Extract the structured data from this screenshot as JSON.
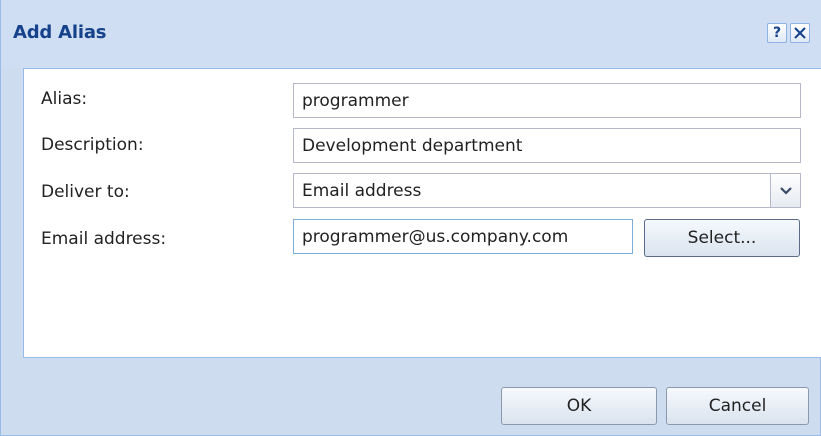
{
  "dialog": {
    "title": "Add Alias",
    "help_icon_label": "?",
    "close_icon_label": "X",
    "icons": {
      "help": "help-icon",
      "close": "close-icon",
      "combo": "chevron-down-icon"
    }
  },
  "form": {
    "alias": {
      "label": "Alias:",
      "value": "programmer"
    },
    "description": {
      "label": "Description:",
      "value": "Development department"
    },
    "deliver_to": {
      "label": "Deliver to:",
      "value": "Email address"
    },
    "email": {
      "label": "Email address:",
      "value": "programmer@us.company.com"
    }
  },
  "buttons": {
    "select": "Select...",
    "ok": "OK",
    "cancel": "Cancel"
  },
  "colors": {
    "title": "#15428b",
    "frame": "#cedcf0",
    "border": "#99bbe8"
  }
}
